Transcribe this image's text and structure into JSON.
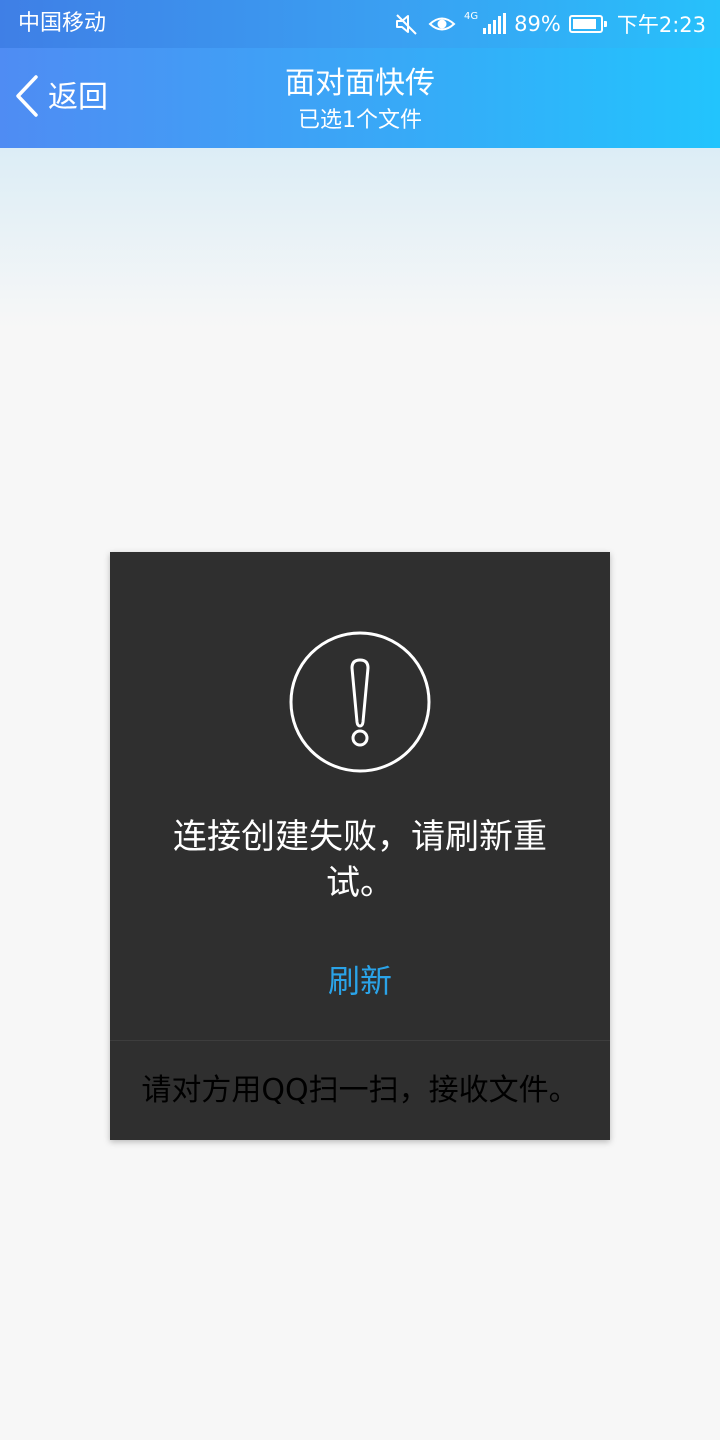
{
  "status_bar": {
    "carrier": "中国移动",
    "network_type": "4G",
    "battery": "89%",
    "battery_level": 0.89,
    "time": "下午2:23",
    "icons": [
      "mute-icon",
      "eye-icon",
      "signal-icon",
      "battery-icon"
    ]
  },
  "header": {
    "back_label": "返回",
    "title": "面对面快传",
    "subtitle": "已选1个文件"
  },
  "dialog": {
    "icon": "alert-circle-icon",
    "message": "连接创建失败，请刷新重试。",
    "refresh_label": "刷新",
    "footer_text": "请对方用QQ扫一扫，接收文件。"
  },
  "colors": {
    "header_gradient_start": "#4f8cf3",
    "header_gradient_end": "#22c4fd",
    "dialog_background": "#2f2f2f",
    "accent": "#2aa3e8",
    "page_background": "#f7f7f7"
  }
}
